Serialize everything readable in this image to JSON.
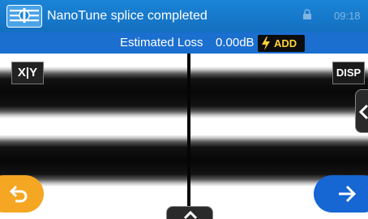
{
  "header": {
    "title": "NanoTune splice completed",
    "clock": "09:18",
    "logo_icon": "splicer-logo-icon",
    "status_icon": "lock-icon"
  },
  "loss_bar": {
    "label": "Estimated Loss",
    "value": "0.00dB",
    "add_label": "ADD",
    "add_icon": "lightning-bolt-icon"
  },
  "view": {
    "xy_label": "X|Y",
    "disp_label": "DISP",
    "side_tab_icon": "chevron-left-icon",
    "bottom_tab_icon": "chevron-up-icon"
  },
  "navigation": {
    "back_icon": "undo-arrow-icon",
    "next_icon": "arrow-right-icon"
  },
  "colors": {
    "title_bar": "#1b84d6",
    "loss_bar": "#1b6fcf",
    "add_text": "#ffd23a",
    "back_button": "#f5a623",
    "next_button": "#1666d4"
  }
}
